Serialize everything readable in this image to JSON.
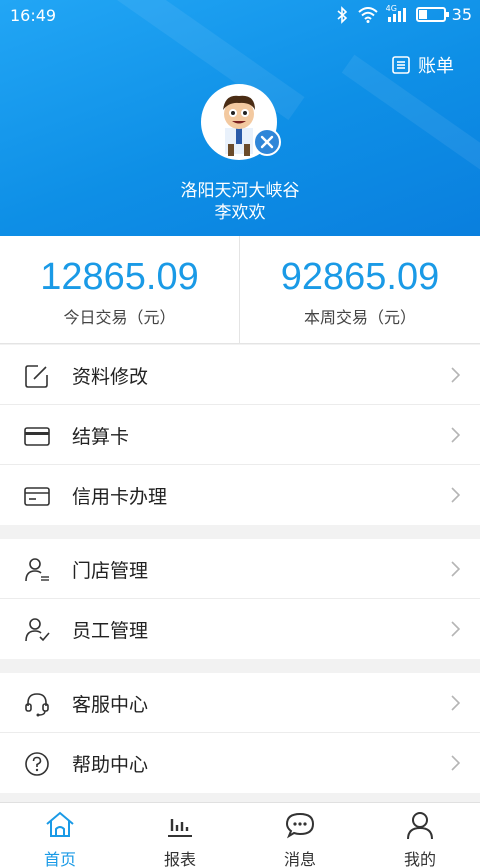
{
  "status_bar": {
    "time": "16:49",
    "network": "4G",
    "battery": "35",
    "battery_level": 0.35
  },
  "header": {
    "bill_label": "账单",
    "shop_name": "洛阳天河大峡谷",
    "user_name": "李欢欢"
  },
  "stats": {
    "today": {
      "value": "12865.09",
      "label": "今日交易（元）"
    },
    "week": {
      "value": "92865.09",
      "label": "本周交易（元）"
    }
  },
  "menu": {
    "group1": [
      {
        "label": "资料修改",
        "icon": "edit-icon"
      },
      {
        "label": "结算卡",
        "icon": "card-icon"
      },
      {
        "label": "信用卡办理",
        "icon": "credit-card-icon"
      }
    ],
    "group2": [
      {
        "label": "门店管理",
        "icon": "store-manager-icon"
      },
      {
        "label": "员工管理",
        "icon": "staff-manager-icon"
      }
    ],
    "group3": [
      {
        "label": "客服中心",
        "icon": "headset-icon"
      },
      {
        "label": "帮助中心",
        "icon": "help-icon"
      }
    ]
  },
  "tabs": [
    {
      "label": "首页",
      "icon": "home-icon",
      "active": true
    },
    {
      "label": "报表",
      "icon": "chart-icon",
      "active": false
    },
    {
      "label": "消息",
      "icon": "message-icon",
      "active": false
    },
    {
      "label": "我的",
      "icon": "profile-icon",
      "active": false
    }
  ],
  "colors": {
    "accent": "#1a9ae6",
    "header_blue": "#0e8fe6"
  }
}
